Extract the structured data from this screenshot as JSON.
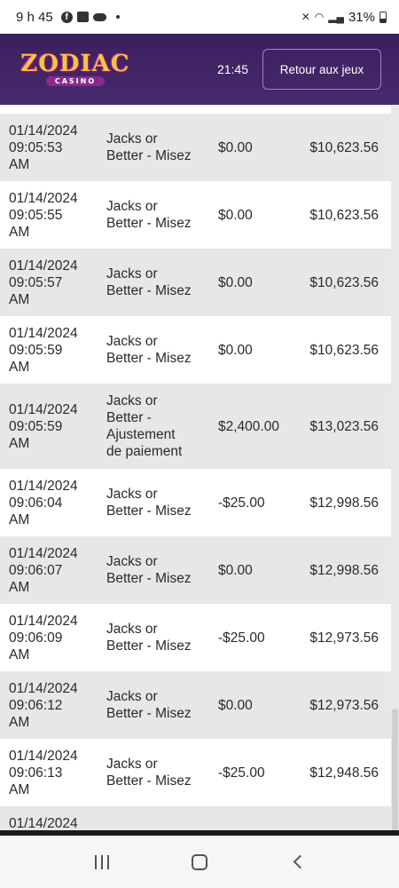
{
  "status_bar": {
    "time": "9 h 45",
    "battery": "31%"
  },
  "header": {
    "logo_main": "ZODIAC",
    "logo_sub": "CASINO",
    "clock": "21:45",
    "back_button_label": "Retour aux jeux",
    "background_color": "#3b1f5e"
  },
  "transactions": [
    {
      "date": "01/14/2024",
      "time": "09:05:53",
      "ampm": "AM",
      "game": [
        "Jacks or",
        "Better - Misez"
      ],
      "amount": "$0.00",
      "balance": "$10,623.56"
    },
    {
      "date": "01/14/2024",
      "time": "09:05:55",
      "ampm": "AM",
      "game": [
        "Jacks or",
        "Better - Misez"
      ],
      "amount": "$0.00",
      "balance": "$10,623.56"
    },
    {
      "date": "01/14/2024",
      "time": "09:05:57",
      "ampm": "AM",
      "game": [
        "Jacks or",
        "Better - Misez"
      ],
      "amount": "$0.00",
      "balance": "$10,623.56"
    },
    {
      "date": "01/14/2024",
      "time": "09:05:59",
      "ampm": "AM",
      "game": [
        "Jacks or",
        "Better - Misez"
      ],
      "amount": "$0.00",
      "balance": "$10,623.56"
    },
    {
      "date": "01/14/2024",
      "time": "09:05:59",
      "ampm": "AM",
      "game": [
        "Jacks or",
        "Better -",
        "Ajustement",
        "de paiement"
      ],
      "amount": "$2,400.00",
      "balance": "$13,023.56"
    },
    {
      "date": "01/14/2024",
      "time": "09:06:04",
      "ampm": "AM",
      "game": [
        "Jacks or",
        "Better - Misez"
      ],
      "amount": "-$25.00",
      "balance": "$12,998.56"
    },
    {
      "date": "01/14/2024",
      "time": "09:06:07",
      "ampm": "AM",
      "game": [
        "Jacks or",
        "Better - Misez"
      ],
      "amount": "$0.00",
      "balance": "$12,998.56"
    },
    {
      "date": "01/14/2024",
      "time": "09:06:09",
      "ampm": "AM",
      "game": [
        "Jacks or",
        "Better - Misez"
      ],
      "amount": "-$25.00",
      "balance": "$12,973.56"
    },
    {
      "date": "01/14/2024",
      "time": "09:06:12",
      "ampm": "AM",
      "game": [
        "Jacks or",
        "Better - Misez"
      ],
      "amount": "$0.00",
      "balance": "$12,973.56"
    },
    {
      "date": "01/14/2024",
      "time": "09:06:13",
      "ampm": "AM",
      "game": [
        "Jacks or",
        "Better - Misez"
      ],
      "amount": "-$25.00",
      "balance": "$12,948.56"
    },
    {
      "date": "01/14/2024",
      "time": "",
      "ampm": "",
      "game": [],
      "amount": "",
      "balance": ""
    }
  ]
}
